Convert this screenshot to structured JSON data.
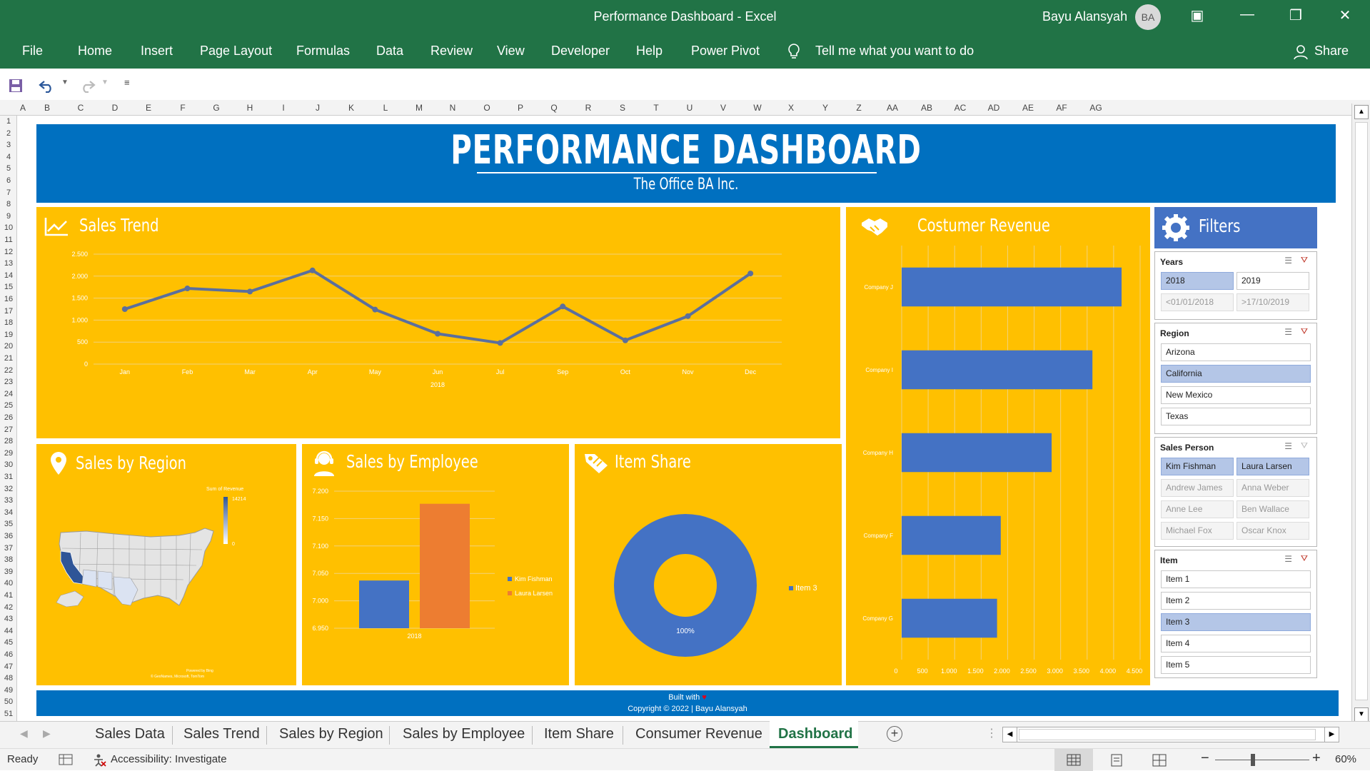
{
  "window": {
    "title": "Performance Dashboard  -  Excel",
    "user": "Bayu Alansyah",
    "avatar": "BA"
  },
  "ribbon": {
    "tabs": [
      "File",
      "Home",
      "Insert",
      "Page Layout",
      "Formulas",
      "Data",
      "Review",
      "View",
      "Developer",
      "Help",
      "Power Pivot"
    ],
    "tell_me": "Tell me what you want to do",
    "share": "Share"
  },
  "grid": {
    "columns": [
      "A",
      "B",
      "C",
      "D",
      "E",
      "F",
      "G",
      "H",
      "I",
      "J",
      "K",
      "L",
      "M",
      "N",
      "O",
      "P",
      "Q",
      "R",
      "S",
      "T",
      "U",
      "V",
      "W",
      "X",
      "Y",
      "Z",
      "AA",
      "AB",
      "AC",
      "AD",
      "AE",
      "AF",
      "AG"
    ],
    "rows": [
      "1",
      "2",
      "3",
      "4",
      "5",
      "6",
      "7",
      "8",
      "9",
      "10",
      "11",
      "12",
      "13",
      "14",
      "15",
      "16",
      "17",
      "18",
      "19",
      "20",
      "21",
      "22",
      "23",
      "24",
      "25",
      "26",
      "27",
      "28",
      "29",
      "30",
      "31",
      "32",
      "33",
      "34",
      "35",
      "36",
      "37",
      "38",
      "39",
      "40",
      "41",
      "42",
      "43",
      "44",
      "45",
      "46",
      "47",
      "48",
      "49",
      "50",
      "51"
    ]
  },
  "dashboard": {
    "title": "PERFORMANCE DASHBOARD",
    "subtitle": "The Office BA Inc.",
    "footer_built": "Built with",
    "footer_copy": "Copyright © 2022 | Bayu Alansyah",
    "panels": {
      "sales_trend": "Sales Trend",
      "sales_region": "Sales by Region",
      "sales_employee": "Sales by Employee",
      "item_share": "Item Share",
      "customer_revenue": "Costumer Revenue",
      "filters": "Filters"
    },
    "map": {
      "legend_title": "Sum of Revenue",
      "legend_max": "14214",
      "legend_min": "0",
      "powered": "Powered by Bing",
      "credits": "© GeoNames, Microsoft, TomTom"
    }
  },
  "chart_data": [
    {
      "type": "line",
      "title": "Sales Trend",
      "categories": [
        "Jan",
        "Feb",
        "Mar",
        "Apr",
        "May",
        "Jun",
        "Jul",
        "Sep",
        "Oct",
        "Nov",
        "Dec"
      ],
      "values": [
        1250,
        1720,
        1650,
        2130,
        1240,
        690,
        480,
        1310,
        540,
        1090,
        2060
      ],
      "xlabel": "2018",
      "ylim": [
        0,
        2500
      ],
      "yticks": [
        "2.500",
        "2.000",
        "1.500",
        "1.000",
        "500",
        "0"
      ],
      "color": "#4472c4"
    },
    {
      "type": "bar",
      "title": "Sales by Employee",
      "categories": [
        "2018"
      ],
      "series": [
        {
          "name": "Kim Fishman",
          "values": [
            7037
          ],
          "color": "#4472c4"
        },
        {
          "name": "Laura Larsen",
          "values": [
            7177
          ],
          "color": "#ed7d31"
        }
      ],
      "ylim": [
        6950,
        7200
      ],
      "yticks": [
        "7.200",
        "7.150",
        "7.100",
        "7.050",
        "7.000",
        "6.950"
      ]
    },
    {
      "type": "pie",
      "title": "Item Share",
      "series": [
        {
          "name": "Item 3",
          "values": [
            100
          ],
          "color": "#4472c4"
        }
      ],
      "data_label": "100%"
    },
    {
      "type": "bar",
      "title": "Costumer Revenue",
      "categories": [
        "Company J",
        "Company I",
        "Company H",
        "Company F",
        "Company G"
      ],
      "values": [
        4150,
        3600,
        2830,
        1870,
        1800
      ],
      "xlim": [
        0,
        4500
      ],
      "xticks": [
        "0",
        "500",
        "1.000",
        "1.500",
        "2.000",
        "2.500",
        "3.000",
        "3.500",
        "4.000",
        "4.500"
      ],
      "color": "#4472c4"
    }
  ],
  "slicers": [
    {
      "title": "Years",
      "items": [
        {
          "label": "2018",
          "state": "sel"
        },
        {
          "label": "2019",
          "state": ""
        },
        {
          "label": "<01/01/2018",
          "state": "dim"
        },
        {
          "label": ">17/10/2019",
          "state": "dim"
        }
      ]
    },
    {
      "title": "Region",
      "items": [
        {
          "label": "Arizona",
          "state": ""
        },
        {
          "label": "California",
          "state": "sel"
        },
        {
          "label": "New Mexico",
          "state": ""
        },
        {
          "label": "Texas",
          "state": ""
        }
      ]
    },
    {
      "title": "Sales Person",
      "items": [
        {
          "label": "Kim Fishman",
          "state": "sel"
        },
        {
          "label": "Laura Larsen",
          "state": "sel"
        },
        {
          "label": "Andrew James",
          "state": "dim"
        },
        {
          "label": "Anna Weber",
          "state": "dim"
        },
        {
          "label": "Anne Lee",
          "state": "dim"
        },
        {
          "label": "Ben Wallace",
          "state": "dim"
        },
        {
          "label": "Michael Fox",
          "state": "dim"
        },
        {
          "label": "Oscar Knox",
          "state": "dim"
        }
      ]
    },
    {
      "title": "Item",
      "items": [
        {
          "label": "Item 1",
          "state": ""
        },
        {
          "label": "Item 2",
          "state": ""
        },
        {
          "label": "Item 3",
          "state": "sel"
        },
        {
          "label": "Item 4",
          "state": ""
        },
        {
          "label": "Item 5",
          "state": ""
        }
      ]
    }
  ],
  "sheet_tabs": [
    "Sales Data",
    "Sales Trend",
    "Sales by Region",
    "Sales by Employee",
    "Item Share",
    "Consumer Revenue",
    "Dashboard"
  ],
  "status": {
    "ready": "Ready",
    "accessibility": "Accessibility: Investigate",
    "zoom": "60%"
  },
  "colors": {
    "excel_green": "#217346",
    "banner_blue": "#0070c0",
    "panel_yellow": "#ffc000",
    "filters_blue": "#4472c4"
  }
}
